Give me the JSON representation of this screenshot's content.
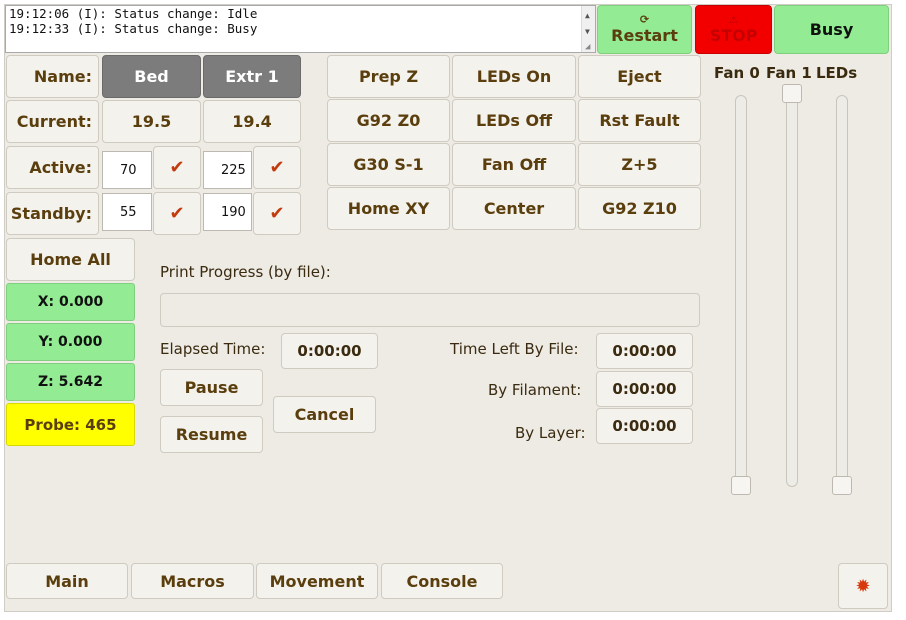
{
  "log": {
    "lines": [
      "19:12:06 (I): Status change: Idle",
      "19:12:33 (I): Status change: Busy"
    ]
  },
  "top_buttons": {
    "restart": "Restart",
    "stop": "STOP",
    "status": "Busy"
  },
  "heaters": {
    "name_label": "Name:",
    "current_label": "Current:",
    "active_label": "Active:",
    "standby_label": "Standby:",
    "columns": [
      {
        "name": "Bed",
        "current": "19.5",
        "active": "70",
        "standby": "55"
      },
      {
        "name": "Extr 1",
        "current": "19.4",
        "active": "225",
        "standby": "190"
      }
    ]
  },
  "macro_grid": [
    [
      "Prep Z",
      "LEDs On",
      "Eject"
    ],
    [
      "G92 Z0",
      "LEDs Off",
      "Rst Fault"
    ],
    [
      "G30 S-1",
      "Fan Off",
      "Z+5"
    ],
    [
      "Home XY",
      "Center",
      "G92 Z10"
    ]
  ],
  "axes": {
    "home_all": "Home All",
    "x": "X: 0.000",
    "y": "Y: 0.000",
    "z": "Z: 5.642",
    "probe": "Probe: 465"
  },
  "print": {
    "progress_label": "Print Progress (by file):",
    "progress_fraction": 0,
    "elapsed_label": "Elapsed Time:",
    "elapsed_value": "0:00:00",
    "time_left_file_label": "Time Left By File:",
    "time_left_file_value": "0:00:00",
    "filament_label": "By Filament:",
    "filament_value": "0:00:00",
    "layer_label": "By Layer:",
    "layer_value": "0:00:00",
    "pause": "Pause",
    "resume": "Resume",
    "cancel": "Cancel"
  },
  "sliders": {
    "labels": [
      "Fan 0",
      "Fan 1",
      "LEDs"
    ],
    "values": [
      0,
      1,
      0
    ]
  },
  "tabs": [
    "Main",
    "Macros",
    "Movement",
    "Console"
  ],
  "colors": {
    "green": "#93ec93",
    "red": "#f20000",
    "yellow": "#ffff00",
    "text_brown": "#5a3e0e",
    "check": "#c23b0e"
  }
}
